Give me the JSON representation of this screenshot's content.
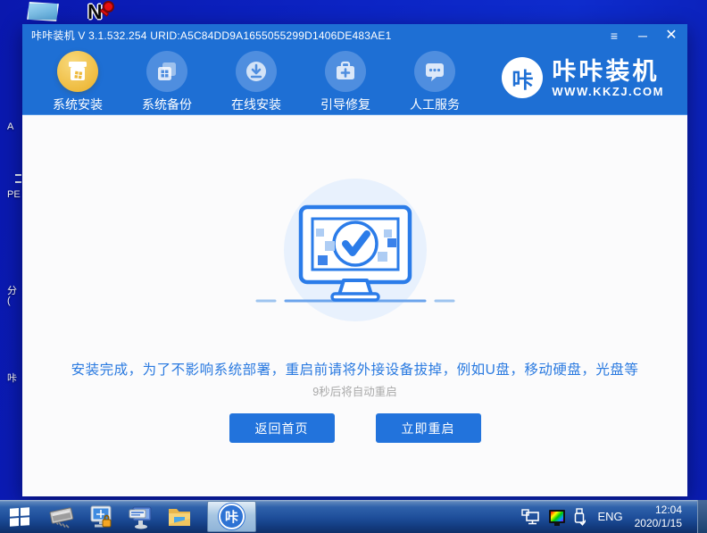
{
  "desktop": {
    "edge_labels": {
      "l0": "A",
      "l1": "PE",
      "l2": "分",
      "l3": "(",
      "l4": "咔"
    },
    "icons": [
      "computer-icon",
      "nkey-password-tool-icon"
    ]
  },
  "window": {
    "title": "咔咔装机 V 3.1.532.254 URID:A5C84DD9A1655055299D1406DE483AE1",
    "controls": {
      "menu": "≡",
      "minimize": "─",
      "close": "✕"
    },
    "nav": [
      {
        "label": "系统安装",
        "icon": "install-box-icon",
        "active": true
      },
      {
        "label": "系统备份",
        "icon": "backup-copy-icon",
        "active": false
      },
      {
        "label": "在线安装",
        "icon": "download-icon",
        "active": false
      },
      {
        "label": "引导修复",
        "icon": "repair-toolbox-icon",
        "active": false
      },
      {
        "label": "人工服务",
        "icon": "chat-service-icon",
        "active": false
      }
    ],
    "logo": {
      "badge": "咔",
      "name": "咔咔装机",
      "url": "WWW.KKZJ.COM"
    },
    "main": {
      "message": "安装完成，为了不影响系统部署，重启前请将外接设备拔掉，例如U盘，移动硬盘，光盘等",
      "countdown": "9秒后将自动重启",
      "buttons": {
        "home": "返回首页",
        "restart": "立即重启"
      },
      "illustration": "monitor-check-success"
    }
  },
  "taskbar": {
    "items": [
      "start-button",
      "memory-chip-icon",
      "monitor-lock-icon",
      "monitor-keyboard-icon",
      "folder-icon",
      "kaka-app-button"
    ],
    "tray": {
      "icons": [
        "network-icon",
        "display-color-icon",
        "usb-icon"
      ],
      "lang": "ENG",
      "time": "12:04",
      "date": "2020/1/15"
    }
  },
  "colors": {
    "desktop": "#0c24c4",
    "header": "#1e6fd4",
    "accent_gold": "#eeba3c",
    "button": "#2273dc",
    "message": "#2a7ae0",
    "illustration": "#2b7ce9"
  }
}
